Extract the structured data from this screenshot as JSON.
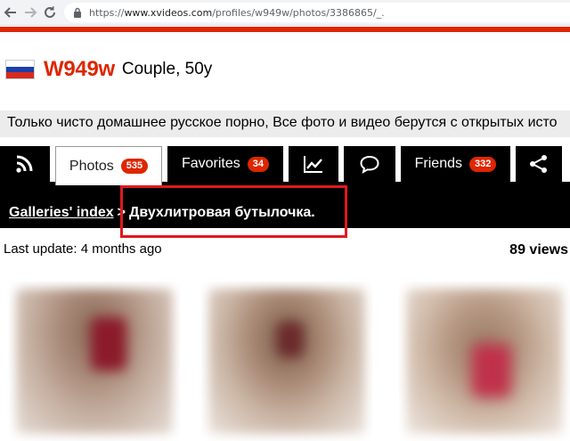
{
  "browser": {
    "url_scheme": "https://",
    "url_host": "www.xvideos.com",
    "url_path": "/profiles/w949w/photos/3386865/_."
  },
  "profile": {
    "username": "W949w",
    "type": "Couple, 50y",
    "about": "Только чисто домашнее русское порно, Все фото и видео берутся с открытых исто"
  },
  "tabs": [
    {
      "icon": "rss-icon"
    },
    {
      "label": "Photos",
      "count": "535"
    },
    {
      "label": "Favorites",
      "count": "34"
    },
    {
      "icon": "chart-icon"
    },
    {
      "icon": "comment-icon"
    },
    {
      "label": "Friends",
      "count": "332"
    },
    {
      "icon": "share-icon"
    }
  ],
  "breadcrumb": {
    "index_label": "Galleries' index",
    "separator": ">",
    "current": "Двухлитровая бутылочка."
  },
  "gallery": {
    "last_update": "Last update: 4 months ago",
    "views": "89 views"
  },
  "colors": {
    "brand_red": "#de2600",
    "highlight_red": "#e0191d"
  }
}
